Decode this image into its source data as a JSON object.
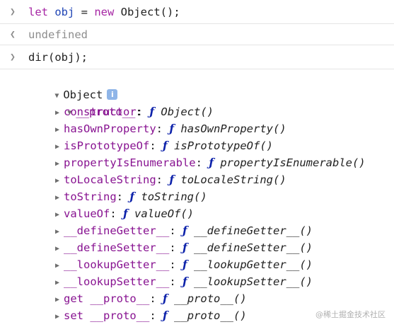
{
  "console": {
    "line1": {
      "kw_let": "let",
      "var_obj": "obj",
      "equals": " = ",
      "kw_new": "new",
      "rest": " Object();"
    },
    "result1": "undefined",
    "line2": "dir(obj);"
  },
  "tree": {
    "root_label": "Object",
    "info_glyph": "i",
    "proto_label": "__proto__",
    "proto_colon": ":",
    "fn_symbol": "ƒ",
    "props": [
      {
        "name": "constructor",
        "value": "Object()"
      },
      {
        "name": "hasOwnProperty",
        "value": "hasOwnProperty()"
      },
      {
        "name": "isPrototypeOf",
        "value": "isPrototypeOf()"
      },
      {
        "name": "propertyIsEnumerable",
        "value": "propertyIsEnumerable()"
      },
      {
        "name": "toLocaleString",
        "value": "toLocaleString()"
      },
      {
        "name": "toString",
        "value": "toString()"
      },
      {
        "name": "valueOf",
        "value": "valueOf()"
      },
      {
        "name": "__defineGetter__",
        "value": "__defineGetter__()"
      },
      {
        "name": "__defineSetter__",
        "value": "__defineSetter__()"
      },
      {
        "name": "__lookupGetter__",
        "value": "__lookupGetter__()"
      },
      {
        "name": "__lookupSetter__",
        "value": "__lookupSetter__()"
      },
      {
        "name": "get __proto__",
        "value": "__proto__()"
      },
      {
        "name": "set __proto__",
        "value": "__proto__()"
      }
    ]
  },
  "watermark": "@稀土掘金技术社区",
  "colors": {
    "keyword": "#a626a4",
    "variable": "#1f44b5",
    "property": "#881391",
    "function_symbol": "#0d22aa"
  },
  "icons": [
    "chevron-right-icon",
    "chevron-left-icon",
    "triangle-down-icon",
    "triangle-right-icon",
    "info-icon"
  ]
}
